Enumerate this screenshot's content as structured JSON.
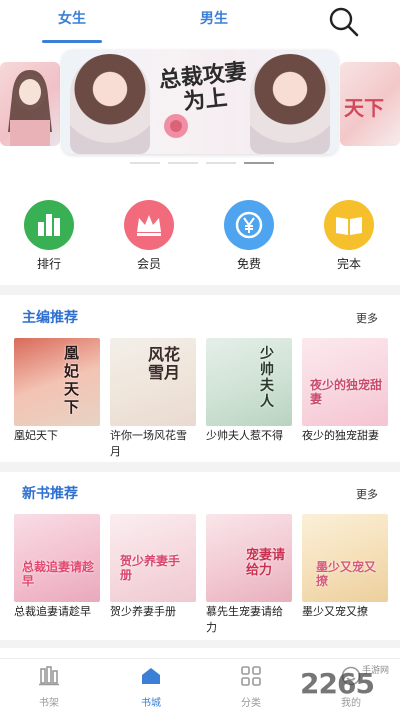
{
  "tabs": [
    {
      "label": "女生",
      "active": true
    },
    {
      "label": "男生",
      "active": false
    }
  ],
  "banner": {
    "title": "总裁攻妻为上",
    "left_card_title": "",
    "right_card_title": "天下",
    "slides_total": 4,
    "active_slide": 4
  },
  "categories": [
    {
      "label": "排行",
      "icon": "ranking-bars-icon",
      "color": "#3ab054"
    },
    {
      "label": "会员",
      "icon": "crown-icon",
      "color": "#f26b7c"
    },
    {
      "label": "免费",
      "icon": "yen-coin-icon",
      "color": "#4fa4ef"
    },
    {
      "label": "完本",
      "icon": "open-book-icon",
      "color": "#f6bf2c"
    }
  ],
  "editor_picks": {
    "title": "主编推荐",
    "more_label": "更多",
    "books": [
      {
        "title": "凰妃天下",
        "cover_text": "凰妃天下"
      },
      {
        "title": "许你一场风花雪月",
        "cover_text": "风花雪月"
      },
      {
        "title": "少帅夫人惹不得",
        "cover_text": "少帅夫人"
      },
      {
        "title": "夜少的独宠甜妻",
        "cover_text": "夜少的独宠甜妻"
      }
    ]
  },
  "new_books": {
    "title": "新书推荐",
    "more_label": "更多",
    "books": [
      {
        "title": "总裁追妻请趁早",
        "cover_text": "总裁追妻请趁早"
      },
      {
        "title": "贺少养妻手册",
        "cover_text": "贺少养妻手册"
      },
      {
        "title": "慕先生宠妻请给力",
        "cover_text": "宠妻请给力"
      },
      {
        "title": "墨少又宠又撩",
        "cover_text": "墨少又宠又撩"
      }
    ]
  },
  "bottom_nav": [
    {
      "label": "书架",
      "icon": "bookshelf-icon",
      "active": false
    },
    {
      "label": "书城",
      "icon": "store-house-icon",
      "active": true
    },
    {
      "label": "分类",
      "icon": "category-grid-icon",
      "active": false
    },
    {
      "label": "我的",
      "icon": "profile-icon",
      "active": false
    }
  ],
  "watermark": {
    "number": "2265",
    "site": "手游网"
  },
  "colors": {
    "accent": "#3b7fd6",
    "section_title": "#2f6fd0"
  }
}
